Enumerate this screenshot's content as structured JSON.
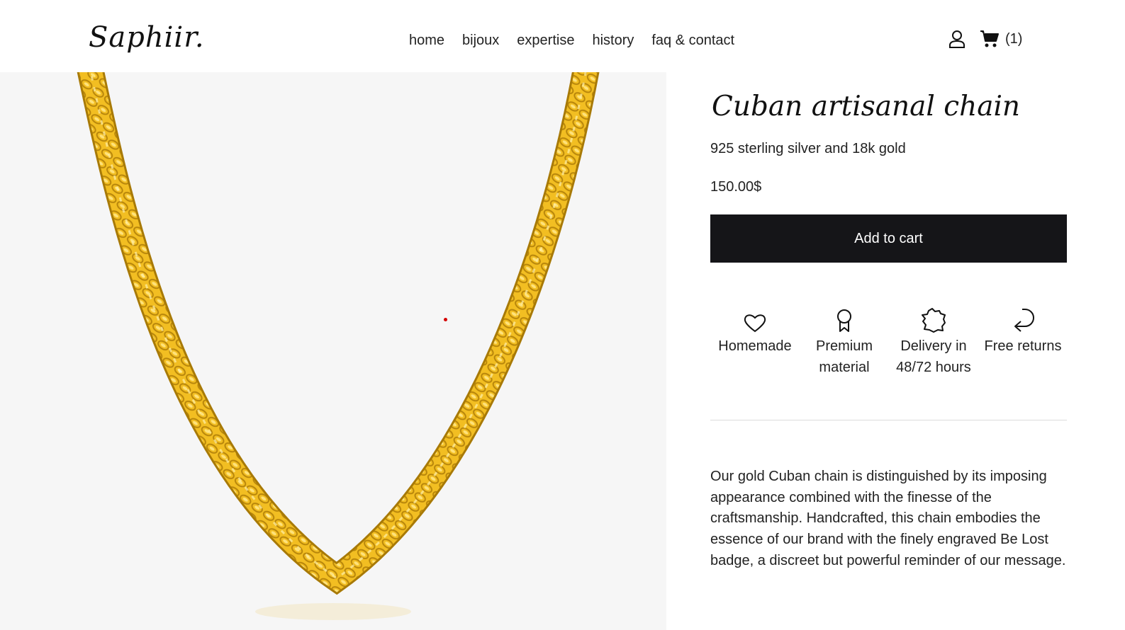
{
  "header": {
    "logo": "Saphiir.",
    "nav": [
      {
        "label": "home"
      },
      {
        "label": "bijoux"
      },
      {
        "label": "expertise"
      },
      {
        "label": "history"
      },
      {
        "label": "faq & contact"
      }
    ],
    "account_icon": "user-icon",
    "cart_icon": "shopping-cart-icon",
    "cart_count": "(1)"
  },
  "product": {
    "image_icon": "gold-chain-necklace",
    "title": "Cuban artisanal chain",
    "subtitle": "925 sterling silver and 18k gold",
    "price": "150.00$",
    "add_to_cart": "Add to cart",
    "features": [
      {
        "icon": "heart-icon",
        "label": "Homemade"
      },
      {
        "icon": "award-ribbon-icon",
        "label": "Premium material"
      },
      {
        "icon": "france-map-icon",
        "label": "Delivery in 48/72 hours"
      },
      {
        "icon": "return-arrow-icon",
        "label": "Free returns"
      }
    ],
    "description": "Our gold Cuban chain is distinguished by its imposing appearance combined with the finesse of the craftsmanship. Handcrafted, this chain embodies the essence of our brand with the finely engraved Be Lost badge, a discreet but powerful reminder of our message."
  },
  "colors": {
    "button_bg": "#151518",
    "image_bg": "#f6f6f6",
    "gold": "#f2be22"
  }
}
